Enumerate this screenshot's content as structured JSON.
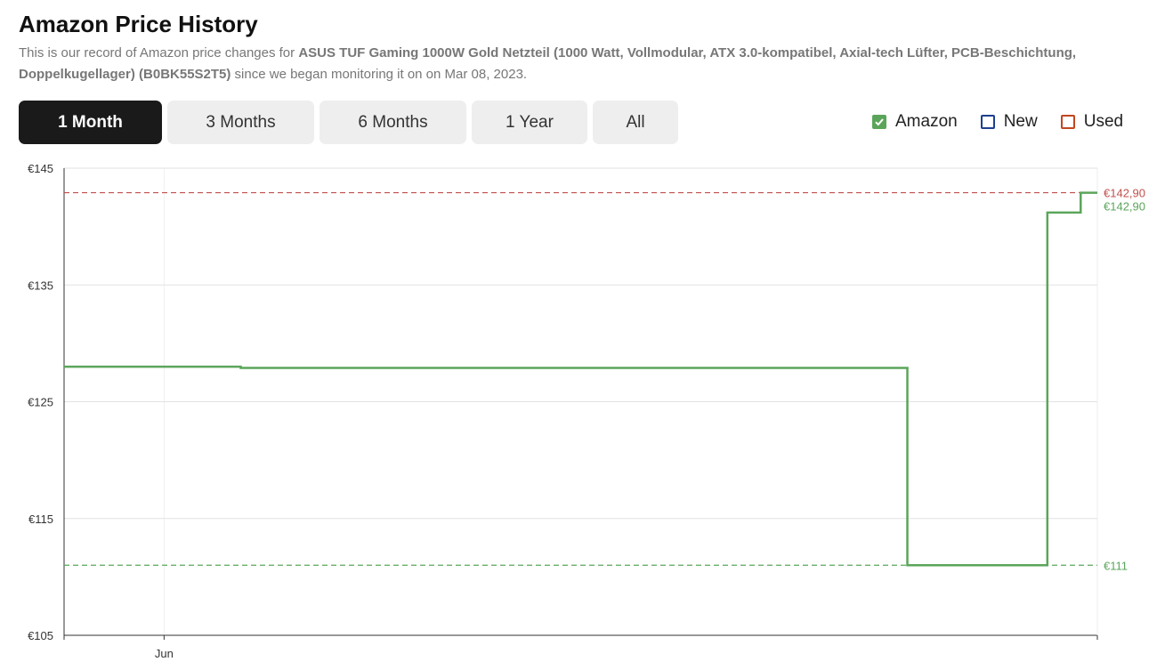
{
  "header": {
    "title": "Amazon Price History",
    "desc_prefix": "This is our record of Amazon price changes for ",
    "product": "ASUS TUF Gaming 1000W Gold Netzteil (1000 Watt, Vollmodular, ATX 3.0-kompatibel, Axial-tech Lüfter, PCB-Beschichtung, Doppelkugellager) (B0BK55S2T5)",
    "desc_suffix": " since we began monitoring it on on Mar 08, 2023."
  },
  "tabs": [
    {
      "label": "1 Month",
      "active": true
    },
    {
      "label": "3 Months",
      "active": false
    },
    {
      "label": "6 Months",
      "active": false
    },
    {
      "label": "1 Year",
      "active": false
    },
    {
      "label": "All",
      "active": false
    }
  ],
  "legend": [
    {
      "label": "Amazon",
      "checked": true,
      "color": "#5ba55b"
    },
    {
      "label": "New",
      "checked": false,
      "color": "#1e3f8f"
    },
    {
      "label": "Used",
      "checked": false,
      "color": "#c2461f"
    }
  ],
  "chart_data": {
    "type": "line",
    "step": true,
    "ylim": [
      105,
      145
    ],
    "y_ticks": [
      105,
      115,
      125,
      135,
      145
    ],
    "y_tick_labels": [
      "€105",
      "€115",
      "€125",
      "€135",
      "€145"
    ],
    "xlim": [
      0,
      31
    ],
    "x_ticks": [
      {
        "x": 3,
        "label": "Jun"
      }
    ],
    "grid": true,
    "series": [
      {
        "name": "Amazon",
        "color": "#5ba55b",
        "points": [
          {
            "x": 0,
            "y": 128
          },
          {
            "x": 5.3,
            "y": 127.9
          },
          {
            "x": 25.3,
            "y": 111
          },
          {
            "x": 29.5,
            "y": 141.2
          },
          {
            "x": 30.5,
            "y": 142.9
          },
          {
            "x": 31,
            "y": 142.9
          }
        ]
      }
    ],
    "reference_lines": [
      {
        "y": 142.9,
        "color": "#c0504d",
        "label": "€142,90"
      },
      {
        "y": 111,
        "color": "#5ba55b",
        "label": "€111"
      }
    ],
    "end_labels": [
      {
        "y": 142.9,
        "label": "€142,90",
        "color": "#c0504d"
      },
      {
        "y": 142.9,
        "label": "€142,90",
        "color": "#5ba55b"
      },
      {
        "y": 111,
        "label": "€111",
        "color": "#5ba55b"
      }
    ]
  }
}
